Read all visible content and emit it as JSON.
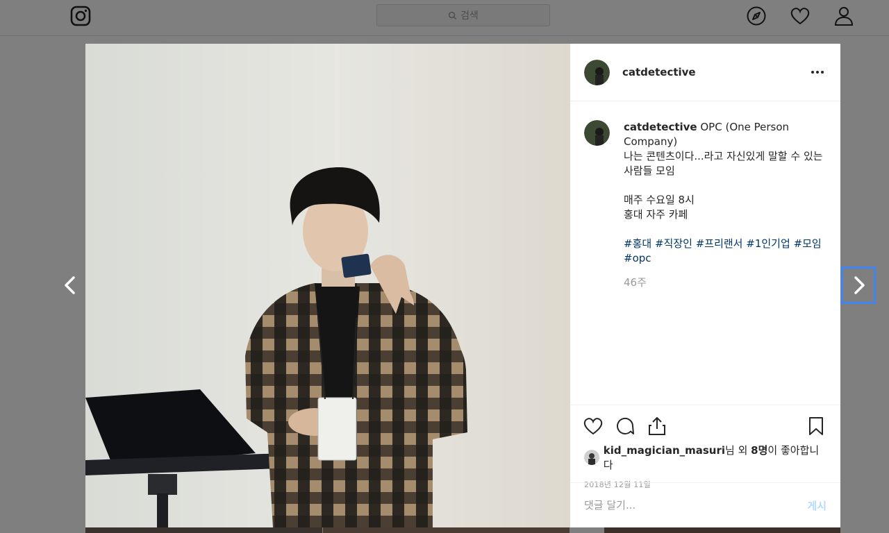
{
  "nav": {
    "search_placeholder": "검색",
    "icons": [
      "instagram-logo",
      "compass-icon",
      "heart-icon",
      "profile-icon"
    ]
  },
  "post": {
    "username": "catdetective",
    "caption_lines": [
      "나는 콘텐츠이다...라고 자신있게 말할 수 있는",
      "사람들 모임",
      "",
      "매주 수요일 8시",
      "홍대 자주 카페"
    ],
    "caption_head": "OPC (One Person Company)",
    "hashtags": [
      "#홍대",
      "#직장인",
      "#프리랜서",
      "#1인기업",
      "#모임",
      "#opc"
    ],
    "time_ago": "46주",
    "liked_by_user": "kid_magician_masuri",
    "liked_by_mid": "님 외 ",
    "liked_count": "8명",
    "liked_by_suffix": "이 좋아합니다",
    "date": "2018년 12월 11일",
    "comment_placeholder": "댓글 달기...",
    "post_button": "게시"
  },
  "colors": {
    "overlay": "#7f7f7f",
    "hashtag": "#003569",
    "post_button": "#b3dbff",
    "focus_ring": "#3f86f4"
  }
}
